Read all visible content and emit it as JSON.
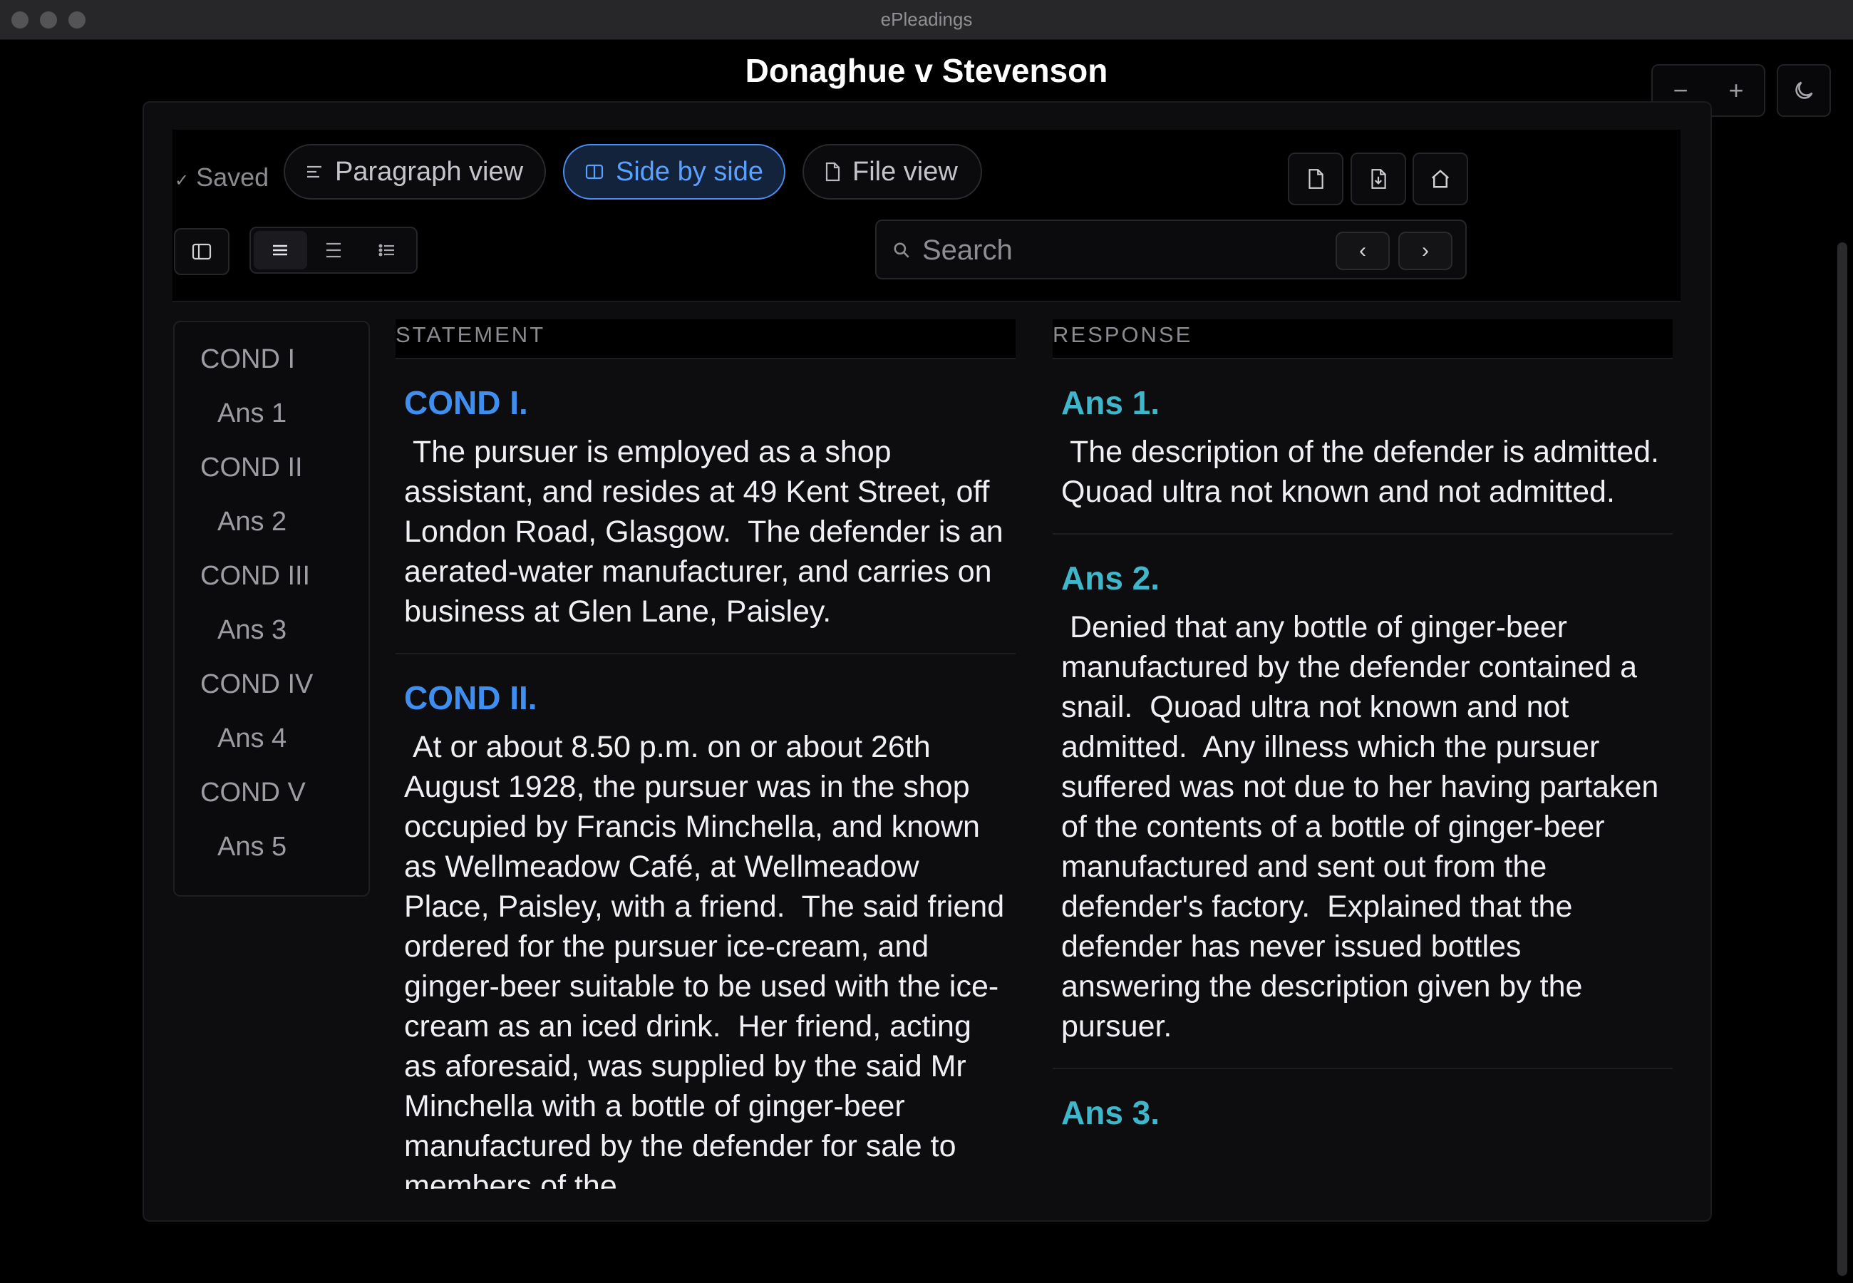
{
  "window": {
    "title": "ePleadings"
  },
  "document": {
    "title": "Donaghue v Stevenson"
  },
  "zoom": {
    "out_label": "−",
    "in_label": "+"
  },
  "status": {
    "saved_label": "Saved"
  },
  "view_tabs": [
    {
      "label": "Paragraph view",
      "active": false
    },
    {
      "label": "Side by side",
      "active": true
    },
    {
      "label": "File view",
      "active": false
    }
  ],
  "search": {
    "placeholder": "Search",
    "prev_label": "‹",
    "next_label": "›"
  },
  "outline": [
    {
      "label": "COND I",
      "kind": "cond"
    },
    {
      "label": "Ans 1",
      "kind": "ans"
    },
    {
      "label": "COND II",
      "kind": "cond"
    },
    {
      "label": "Ans 2",
      "kind": "ans"
    },
    {
      "label": "COND III",
      "kind": "cond"
    },
    {
      "label": "Ans 3",
      "kind": "ans"
    },
    {
      "label": "COND IV",
      "kind": "cond"
    },
    {
      "label": "Ans 4",
      "kind": "ans"
    },
    {
      "label": "COND V",
      "kind": "cond"
    },
    {
      "label": "Ans 5",
      "kind": "ans"
    }
  ],
  "statement": {
    "header": "STATEMENT",
    "paragraphs": [
      {
        "heading": "COND I.",
        "text": " The pursuer is employed as a shop assistant, and resides at 49 Kent Street, off London Road, Glasgow.  The defender is an aerated-water manufacturer, and carries on business at Glen Lane, Paisley."
      },
      {
        "heading": "COND II.",
        "text": " At or about 8.50 p.m. on or about 26th August 1928, the pursuer was in the shop occupied by Francis Minchella, and known as Wellmeadow Café, at Wellmeadow Place, Paisley, with a friend.  The said friend ordered for the pursuer ice-cream, and ginger-beer suitable to be used with the ice-cream as an iced drink.  Her friend, acting as aforesaid, was supplied by the said Mr Minchella with a bottle of ginger-beer manufactured by the defender for sale to members of the"
      }
    ]
  },
  "response": {
    "header": "RESPONSE",
    "paragraphs": [
      {
        "heading": "Ans 1.",
        "text": " The description of the defender is admitted.  Quoad ultra not known and not admitted."
      },
      {
        "heading": "Ans 2.",
        "text": " Denied that any bottle of ginger-beer manufactured by the defender contained a snail.  Quoad ultra not known and not admitted.  Any illness which the pursuer suffered was not due to her having partaken of the contents of a bottle of ginger-beer manufactured and sent out from the defender's factory.  Explained that the defender has never issued bottles answering the description given by the pursuer."
      },
      {
        "heading": "Ans 3.",
        "text": ""
      }
    ]
  },
  "colors": {
    "accent": "#4a8df0",
    "response_heading": "#3fb6c9",
    "background": "#000000"
  }
}
